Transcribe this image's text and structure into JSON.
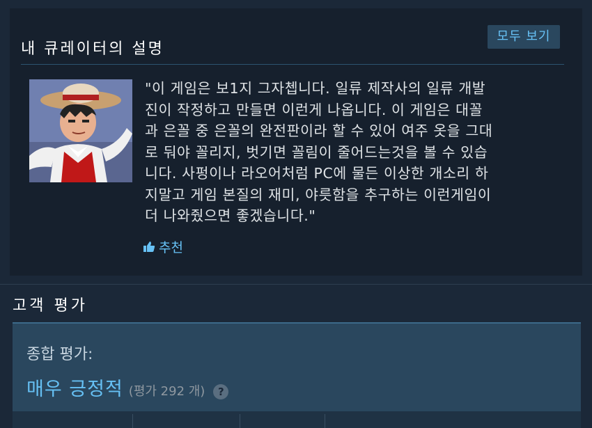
{
  "curator": {
    "title": "내 큐레이터의 설명",
    "view_all_label": "모두 보기",
    "review_text": "\"이 게임은 보1지 그자쳅니다. 일류 제작사의 일류 개발\n진이 작정하고 만들면 이런게 나옵니다. 이 게임은 대꼴\n과 은꼴 중 은꼴의 완전판이라 할 수 있어 여주 옷을 그대\n로 둬야 꼴리지, 벗기면 꼴림이 줄어드는것을 볼 수 있습\n니다. 사펑이나 라오어처럼 PC에 물든 이상한 개소리 하\n지말고 게임 본질의 재미, 야릇함을 추구하는 이런게임이\n더 나와줬으면 좋겠습니다.\"",
    "recommend_label": "추천",
    "avatar_icon": "curator-avatar-image",
    "recommend_icon": "thumbs-up-icon"
  },
  "reviews": {
    "heading": "고객 평가",
    "summary_label": "종합 평가:",
    "summary_rating": "매우 긍정적",
    "summary_count": "(평가 292 개)",
    "help_icon_glyph": "?"
  },
  "colors": {
    "background": "#1b2838",
    "accent_blue": "#66c0f4",
    "panel_blue": "#2a475e"
  }
}
